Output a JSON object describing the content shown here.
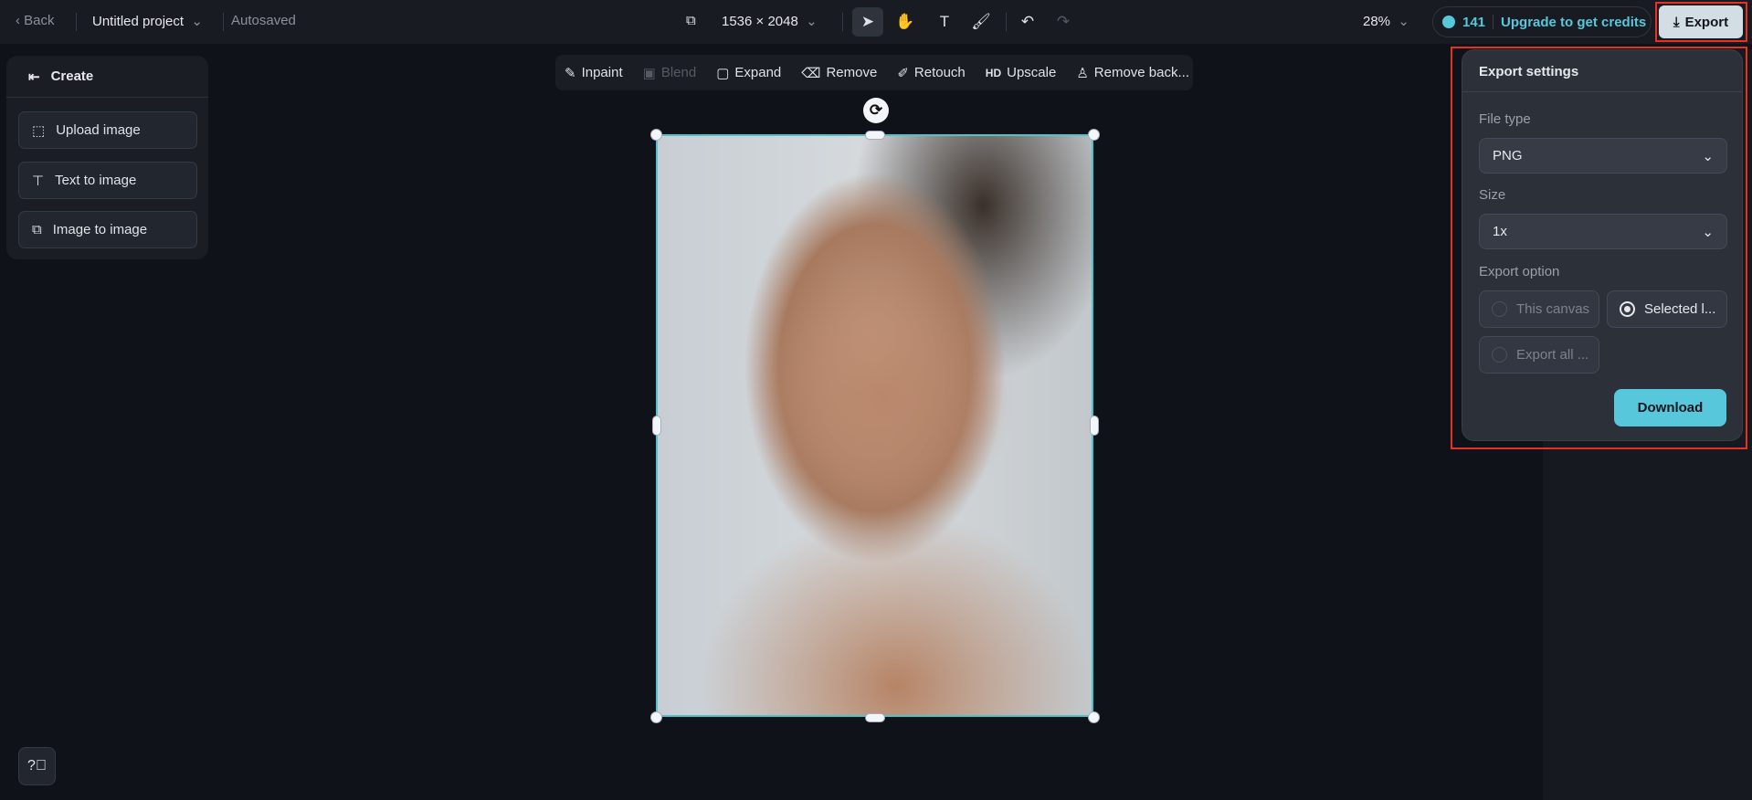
{
  "topbar": {
    "back": "Back",
    "project": "Untitled project",
    "autosaved": "Autosaved",
    "canvas_size": "1536 × 2048",
    "zoom": "28%",
    "credits": "141",
    "upgrade": "Upgrade to get credits",
    "export": "Export"
  },
  "left_panel": {
    "title": "Create",
    "items": [
      {
        "label": "Upload image"
      },
      {
        "label": "Text to image"
      },
      {
        "label": "Image to image"
      }
    ]
  },
  "edit_toolbar": {
    "items": [
      {
        "label": "Inpaint"
      },
      {
        "label": "Blend"
      },
      {
        "label": "Expand"
      },
      {
        "label": "Remove"
      },
      {
        "label": "Retouch"
      },
      {
        "label": "Upscale",
        "icon_text": "HD"
      },
      {
        "label": "Remove back..."
      }
    ]
  },
  "export_settings": {
    "title": "Export settings",
    "file_type_label": "File type",
    "file_type": "PNG",
    "size_label": "Size",
    "size": "1x",
    "option_label": "Export option",
    "options": [
      {
        "label": "This canvas",
        "selected": false
      },
      {
        "label": "Selected l...",
        "selected": true
      },
      {
        "label": "Export all ...",
        "selected": false
      }
    ],
    "download": "Download"
  },
  "colors": {
    "accent": "#57c7db",
    "selection": "#4fc3cc",
    "highlight": "#e8311f"
  }
}
